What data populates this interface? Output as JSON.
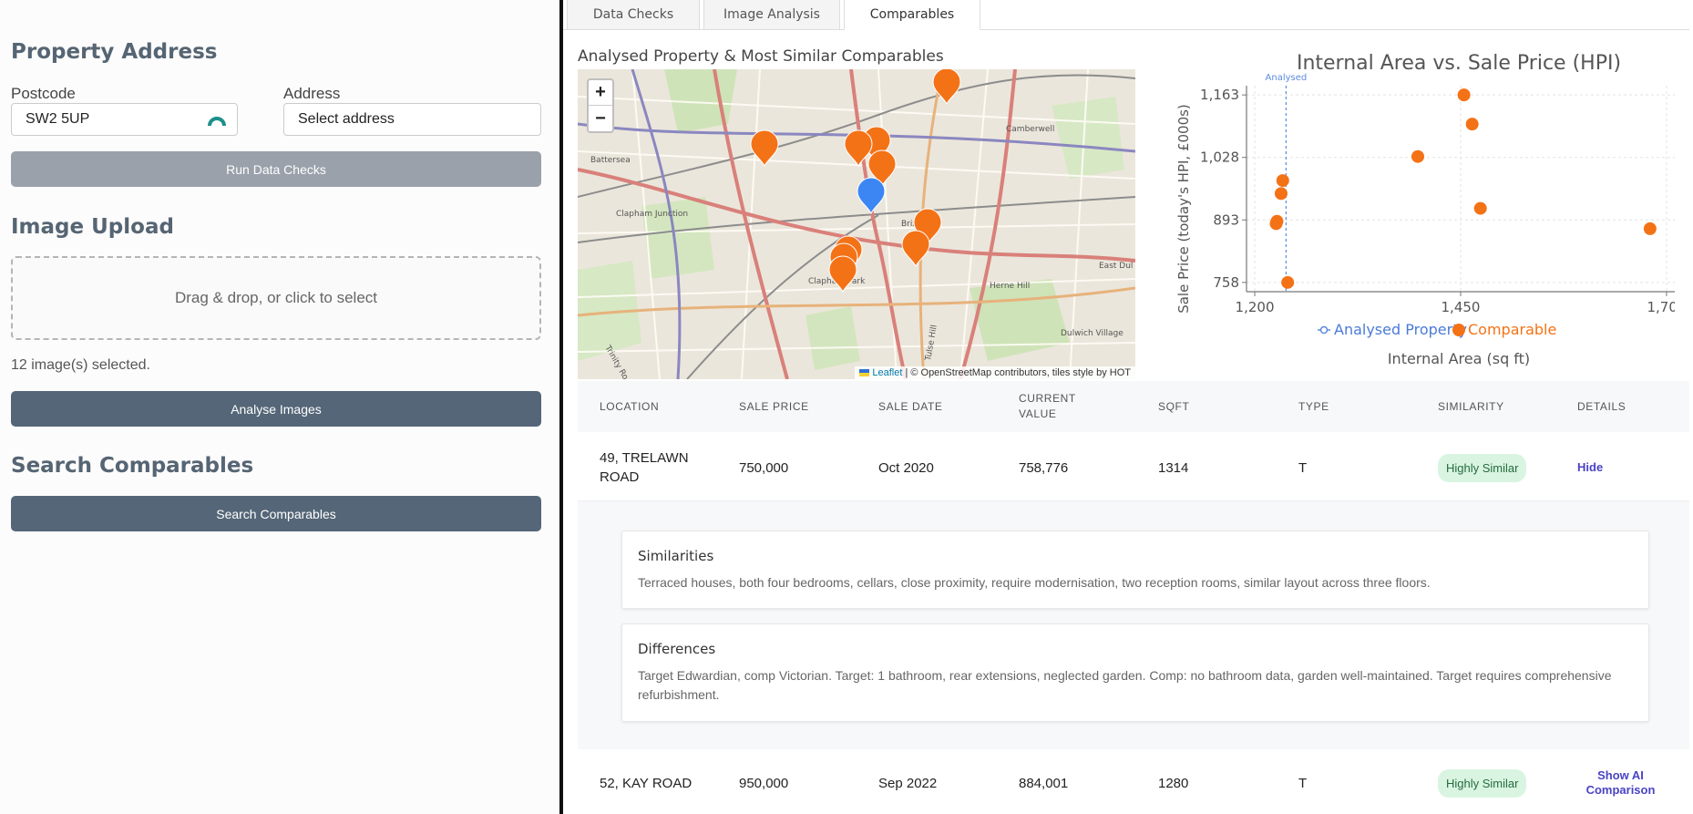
{
  "left": {
    "property_address": {
      "title": "Property Address",
      "postcode_label": "Postcode",
      "postcode_value": "SW2 5UP",
      "address_label": "Address",
      "address_value": "Select address",
      "run_button": "Run Data Checks"
    },
    "image_upload": {
      "title": "Image Upload",
      "dropzone_text": "Drag & drop, or click to select",
      "selected_text": "12 image(s) selected.",
      "analyse_button": "Analyse Images"
    },
    "search": {
      "title": "Search Comparables",
      "button": "Search Comparables"
    }
  },
  "tabs": [
    {
      "label": "Data Checks",
      "active": false
    },
    {
      "label": "Image Analysis",
      "active": false
    },
    {
      "label": "Comparables",
      "active": true
    }
  ],
  "map": {
    "title": "Analysed Property & Most Similar Comparables",
    "zoom_in": "+",
    "zoom_out": "−",
    "attribution_link": "Leaflet",
    "attribution_text": "| © OpenStreetMap contributors, tiles style by HOT",
    "place_labels": [
      "Battersea",
      "Clapham Junction",
      "Brixton",
      "Camberwell",
      "Clapham Park",
      "Herne Hill",
      "Dulwich Village",
      "East Dul",
      "Tulse Hill",
      "Trinity Ro"
    ],
    "colors": {
      "comparable": "#f47216",
      "analysed": "#3c86f4"
    }
  },
  "chart_data": {
    "type": "scatter",
    "title": "Internal Area vs. Sale Price (HPI)",
    "xlabel": "Internal Area (sq ft)",
    "ylabel": "Sale Price (today's HPI, £000s)",
    "xlim": [
      1190,
      1710
    ],
    "ylim": [
      738,
      1183
    ],
    "xticks": [
      1200,
      1450,
      1700
    ],
    "yticks": [
      758,
      893,
      1028,
      1163
    ],
    "xtick_labels": [
      "1,200",
      "1,450",
      "1,700"
    ],
    "ytick_labels": [
      "758",
      "893",
      "1,028",
      "1,163"
    ],
    "grid": true,
    "legend_position": "bottom",
    "legend": [
      "Analysed Property",
      "Comparable"
    ],
    "annotation": "Analysed",
    "analysed_x": 1238,
    "series": [
      {
        "name": "Comparable",
        "color": "#f47216",
        "points": [
          [
            1226,
            885
          ],
          [
            1227,
            890
          ],
          [
            1232,
            950
          ],
          [
            1234,
            978
          ],
          [
            1240,
            758
          ],
          [
            1398,
            1030
          ],
          [
            1454,
            1163
          ],
          [
            1464,
            1100
          ],
          [
            1474,
            918
          ],
          [
            1680,
            874
          ]
        ]
      }
    ]
  },
  "table": {
    "headers": [
      "LOCATION",
      "SALE PRICE",
      "SALE DATE",
      "CURRENT VALUE",
      "SQFT",
      "TYPE",
      "SIMILARITY",
      "DETAILS"
    ],
    "rows": [
      {
        "location": "49, TRELAWN ROAD",
        "sale_price": "750,000",
        "sale_date": "Oct 2020",
        "current_value": "758,776",
        "sqft": "1314",
        "type": "T",
        "similarity": "Highly Similar",
        "details": "Hide"
      },
      {
        "location": "52, KAY ROAD",
        "sale_price": "950,000",
        "sale_date": "Sep 2022",
        "current_value": "884,001",
        "sqft": "1280",
        "type": "T",
        "similarity": "Highly Similar",
        "details": "Show AI Comparison"
      }
    ],
    "expanded": {
      "similarities_title": "Similarities",
      "similarities_text": "Terraced houses, both four bedrooms, cellars, close proximity, require modernisation, two reception rooms, similar layout across three floors.",
      "differences_title": "Differences",
      "differences_text": "Target Edwardian, comp Victorian. Target: 1 bathroom, rear extensions, neglected garden. Comp: no bathroom data, garden well-maintained. Target requires comprehensive refurbishment."
    }
  }
}
